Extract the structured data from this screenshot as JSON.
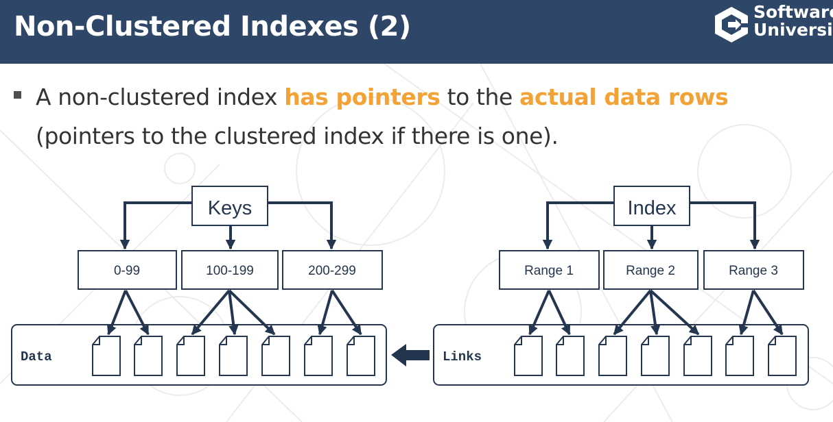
{
  "header": {
    "title": "Non-Clustered Indexes (2)",
    "logo_line1": "Software",
    "logo_line2": "Universi"
  },
  "bullet": {
    "part1": "A non-clustered index ",
    "highlight1": "has pointers",
    "part2": " to the ",
    "highlight2": "actual data rows",
    "part3": "(pointers to the clustered index if there is one)."
  },
  "colors": {
    "header_bg": "#2e4667",
    "accent": "#f3a335",
    "diagram_stroke": "#24364f"
  },
  "diagram": {
    "left_tree": {
      "root": "Keys",
      "children": [
        "0-99",
        "100-199",
        "200-299"
      ],
      "container_label": "Data"
    },
    "right_tree": {
      "root": "Index",
      "children": [
        "Range 1",
        "Range 2",
        "Range 3"
      ],
      "container_label": "Links"
    }
  }
}
